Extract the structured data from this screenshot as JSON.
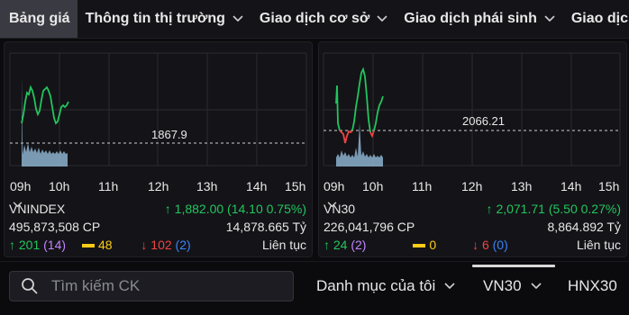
{
  "nav": {
    "items": [
      {
        "label": "Bảng giá",
        "active": true,
        "has_chevron": false
      },
      {
        "label": "Thông tin thị trường",
        "active": false,
        "has_chevron": true
      },
      {
        "label": "Giao dịch cơ sở",
        "active": false,
        "has_chevron": true
      },
      {
        "label": "Giao dịch phái sinh",
        "active": false,
        "has_chevron": true
      },
      {
        "label": "Giao dịch",
        "active": false,
        "has_chevron": false
      }
    ]
  },
  "cards": [
    {
      "time_ticks": [
        "09h",
        "10h",
        "11h",
        "12h",
        "13h",
        "14h",
        "15h"
      ],
      "reference_value": "1867.9",
      "index_name": "VNINDEX",
      "index_value": "1,882.00",
      "index_change": "(14.10 0.75%)",
      "volume": "495,873,508 CP",
      "turnover": "14,878.665 Tỷ",
      "advances": "201",
      "ceiling": "(14)",
      "unchanged": "48",
      "declines": "102",
      "floor": "(2)",
      "session": "Liên tục"
    },
    {
      "time_ticks": [
        "09h",
        "10h",
        "11h",
        "12h",
        "13h",
        "14h",
        "15h"
      ],
      "reference_value": "2066.21",
      "index_name": "VN30",
      "index_value": "2,071.71",
      "index_change": "(5.50 0.27%)",
      "volume": "226,041,796 CP",
      "turnover": "8,864.892 Tỷ",
      "advances": "24",
      "ceiling": "(2)",
      "unchanged": "0",
      "declines": "6",
      "floor": "(0)",
      "session": "Liên tục"
    }
  ],
  "search": {
    "placeholder": "Tìm kiếm CK"
  },
  "tabs": {
    "watchlist": "Danh mục của tôi",
    "vn30": "VN30",
    "hnx30": "HNX30"
  },
  "colors": {
    "up": "#22c55e",
    "down": "#ef4444",
    "ceiling": "#c084fc",
    "floor": "#3b82f6",
    "unchanged": "#facc15",
    "active_tab": "#3a3a42"
  },
  "icons": {
    "chevron": "chevron-down-icon",
    "arrow_up": "arrow-up-icon",
    "arrow_down": "arrow-down-icon",
    "search": "search-icon"
  }
}
